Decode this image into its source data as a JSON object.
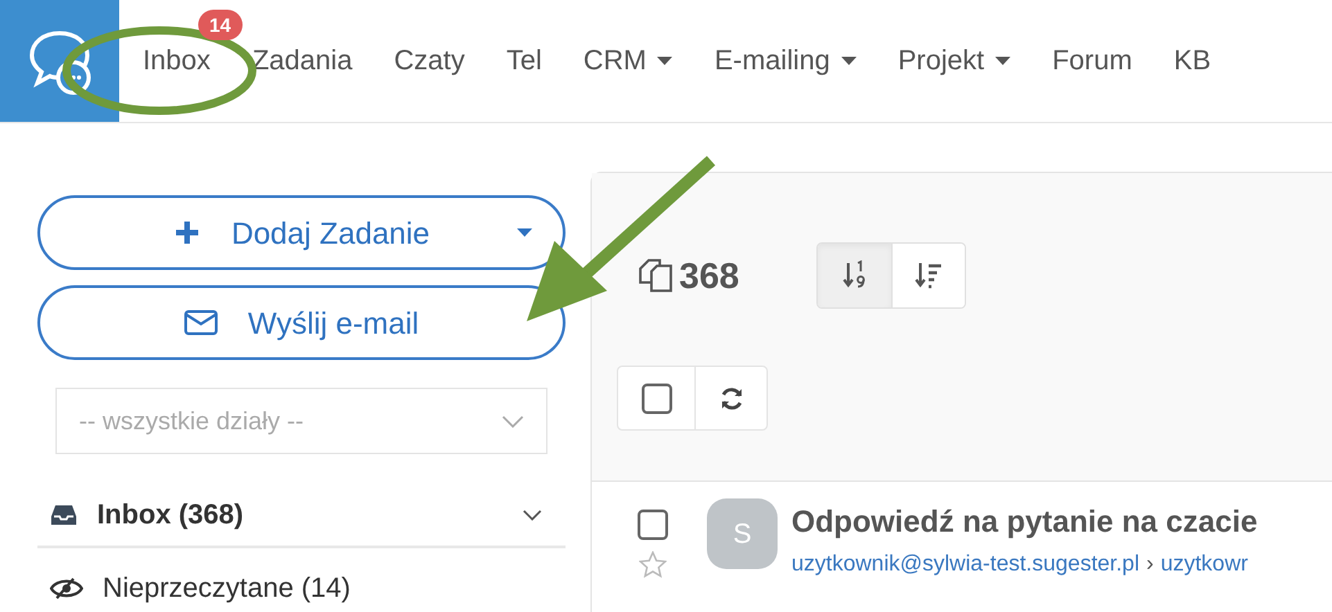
{
  "nav": {
    "items": [
      {
        "label": "Inbox",
        "badge": "14",
        "dropdown": false
      },
      {
        "label": "Zadania",
        "dropdown": false
      },
      {
        "label": "Czaty",
        "dropdown": false
      },
      {
        "label": "Tel",
        "dropdown": false
      },
      {
        "label": "CRM",
        "dropdown": true
      },
      {
        "label": "E-mailing",
        "dropdown": true
      },
      {
        "label": "Projekt",
        "dropdown": true
      },
      {
        "label": "Forum",
        "dropdown": false
      },
      {
        "label": "KB",
        "dropdown": false
      }
    ]
  },
  "sidebar": {
    "add_task_button": "Dodaj Zadanie",
    "send_email_button": "Wyślij e-mail",
    "department_select": {
      "placeholder": "-- wszystkie działy --"
    },
    "folders": [
      {
        "kind": "inbox",
        "label": "Inbox (368)",
        "expanded": false
      },
      {
        "kind": "unread",
        "label": "Nieprzeczytane (14)"
      }
    ]
  },
  "list": {
    "count": "368",
    "sort_buttons": [
      {
        "kind": "numeric",
        "selected": true
      },
      {
        "kind": "filter",
        "selected": false
      }
    ],
    "select_all_checked": false,
    "messages": [
      {
        "checked": false,
        "starred": false,
        "avatar": "S",
        "subject": "Odpowiedź na pytanie na czacie",
        "from": "uzytkownik@sylwia-test.sugester.pl",
        "separator": "›",
        "to": "uzytkowr"
      }
    ]
  }
}
